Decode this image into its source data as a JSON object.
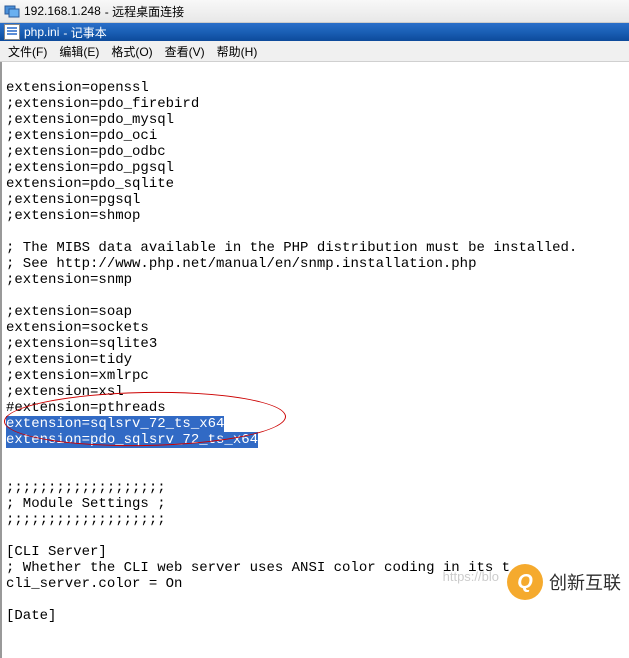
{
  "rdc": {
    "address": "192.168.1.248",
    "suffix": "- 远程桌面连接"
  },
  "notepad": {
    "filename": "php.ini",
    "suffix": "- 记事本"
  },
  "menu": {
    "file": "文件(F)",
    "edit": "编辑(E)",
    "format": "格式(O)",
    "view": "查看(V)",
    "help": "帮助(H)"
  },
  "lines": [
    "extension=openssl",
    ";extension=pdo_firebird",
    ";extension=pdo_mysql",
    ";extension=pdo_oci",
    ";extension=pdo_odbc",
    ";extension=pdo_pgsql",
    "extension=pdo_sqlite",
    ";extension=pgsql",
    ";extension=shmop",
    "",
    "; The MIBS data available in the PHP distribution must be installed.",
    "; See http://www.php.net/manual/en/snmp.installation.php",
    ";extension=snmp",
    "",
    ";extension=soap",
    "extension=sockets",
    ";extension=sqlite3",
    ";extension=tidy",
    ";extension=xmlrpc",
    ";extension=xsl",
    "#extension=pthreads"
  ],
  "highlighted": [
    "extension=sqlsrv_72_ts_x64",
    "extension=pdo_sqlsrv_72_ts_x64"
  ],
  "lines_after": [
    "",
    "",
    ";;;;;;;;;;;;;;;;;;;",
    "; Module Settings ;",
    ";;;;;;;;;;;;;;;;;;;",
    "",
    "[CLI Server]",
    "; Whether the CLI web server uses ANSI color coding in its t",
    "cli_server.color = On",
    "",
    "[Date]"
  ],
  "watermark": {
    "brand": "创新互联",
    "logo_letter": "Q",
    "url_fragment": "https://blo"
  }
}
